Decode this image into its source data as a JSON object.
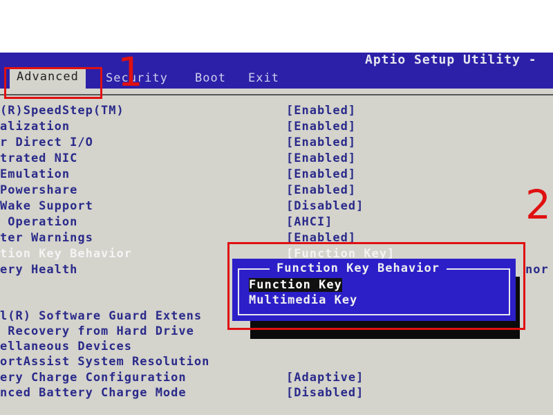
{
  "header": {
    "title": "Aptio Setup Utility -",
    "tabs": [
      "Advanced",
      "Security",
      "Boot",
      "Exit"
    ],
    "active_tab": "Advanced"
  },
  "settings": [
    {
      "label": "(R)SpeedStep(TM)",
      "value": "[Enabled]"
    },
    {
      "label": "alization",
      "value": "[Enabled]"
    },
    {
      "label": "r Direct I/O",
      "value": "[Enabled]"
    },
    {
      "label": "trated NIC",
      "value": "[Enabled]"
    },
    {
      "label": "Emulation",
      "value": "[Enabled]"
    },
    {
      "label": "Powershare",
      "value": "[Enabled]"
    },
    {
      "label": "Wake Support",
      "value": "[Disabled]"
    },
    {
      "label": " Operation",
      "value": "[AHCI]"
    },
    {
      "label": "ter Warnings",
      "value": "[Enabled]"
    },
    {
      "label": "tion Key Behavior",
      "value": "[Function Key]"
    },
    {
      "label": "ery Health",
      "value": "nor"
    },
    {
      "label": "l(R) Software Guard Extens",
      "value": ""
    },
    {
      "label": " Recovery from Hard Drive",
      "value": ""
    },
    {
      "label": "ellaneous Devices",
      "value": ""
    },
    {
      "label": "ortAssist System Resolution",
      "value": ""
    },
    {
      "label": "ery Charge Configuration",
      "value": "[Adaptive]"
    },
    {
      "label": "nced Battery Charge Mode",
      "value": "[Disabled]"
    }
  ],
  "popup": {
    "title": "Function Key Behavior",
    "options": [
      "Function Key",
      "Multimedia Key"
    ],
    "selected": "Function Key"
  },
  "annotations": [
    "1",
    "2"
  ],
  "colors": {
    "header": "#2c20a8",
    "background": "#d4d3cc",
    "popup": "#2c1fc8",
    "annotation": "#e01010"
  }
}
